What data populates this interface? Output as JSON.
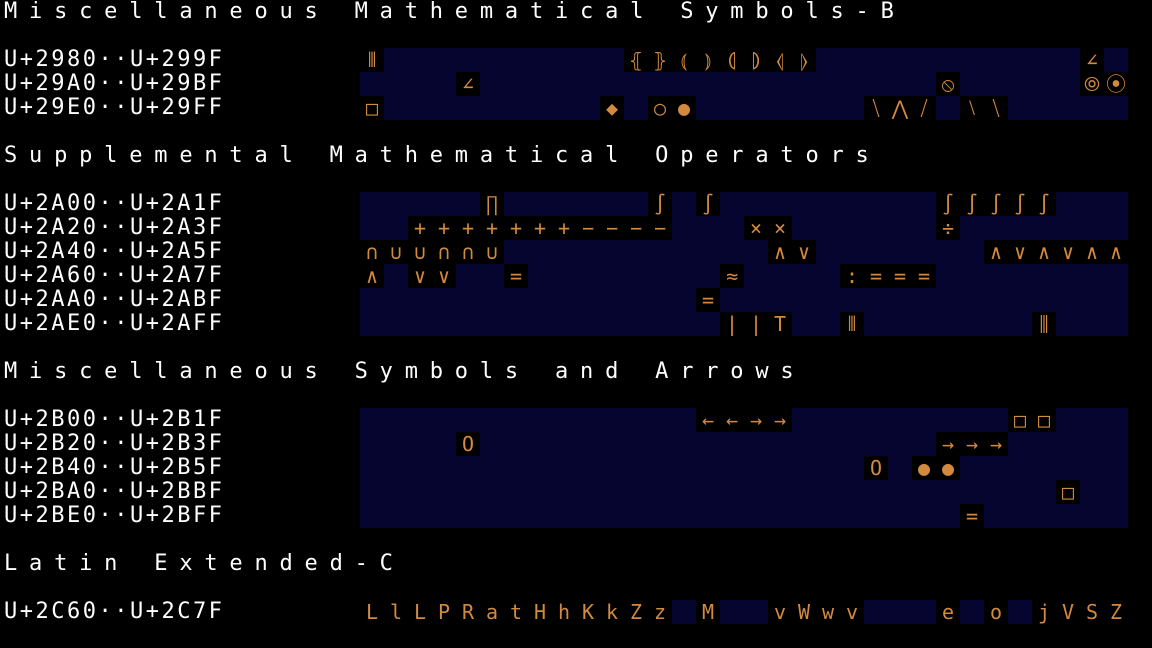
{
  "colors": {
    "background": "#000000",
    "band": "#050530",
    "glyph_bg": "#000000",
    "glyph": "#d28a3e",
    "text": "#ffffff"
  },
  "blocks": [
    {
      "title": "Miscellaneous Mathematical Symbols-B",
      "rows": [
        {
          "label": "U+2980··U+299F",
          "cells": [
            [
              0,
              "⦀"
            ],
            [
              11,
              "⦃"
            ],
            [
              12,
              "⦄"
            ],
            [
              13,
              "⦅"
            ],
            [
              14,
              "⦆"
            ],
            [
              15,
              "⦇"
            ],
            [
              16,
              "⦈"
            ],
            [
              17,
              "⦉"
            ],
            [
              18,
              "⦊"
            ],
            [
              30,
              "∠"
            ]
          ]
        },
        {
          "label": "U+29A0··U+29BF",
          "cells": [
            [
              4,
              "∠"
            ],
            [
              24,
              "⦸"
            ],
            [
              30,
              "⦾"
            ],
            [
              31,
              "⦿"
            ]
          ]
        },
        {
          "label": "U+29E0··U+29FF",
          "cells": [
            [
              0,
              "□"
            ],
            [
              10,
              "◆"
            ],
            [
              12,
              "○"
            ],
            [
              13,
              "●"
            ],
            [
              21,
              "⧹"
            ],
            [
              22,
              "⋀"
            ],
            [
              23,
              "⧸"
            ],
            [
              25,
              "⧵"
            ],
            [
              26,
              "⧹"
            ]
          ]
        }
      ]
    },
    {
      "title": "Supplemental Mathematical Operators",
      "rows": [
        {
          "label": "U+2A00··U+2A1F",
          "cells": [
            [
              5,
              "∏"
            ],
            [
              12,
              "∫"
            ],
            [
              14,
              "∫"
            ],
            [
              24,
              "∫"
            ],
            [
              25,
              "∫"
            ],
            [
              26,
              "∫"
            ],
            [
              27,
              "∫"
            ],
            [
              28,
              "∫"
            ]
          ]
        },
        {
          "label": "U+2A20··U+2A3F",
          "cells": [
            [
              2,
              "+"
            ],
            [
              3,
              "+"
            ],
            [
              4,
              "+"
            ],
            [
              5,
              "+"
            ],
            [
              6,
              "+"
            ],
            [
              7,
              "+"
            ],
            [
              8,
              "+"
            ],
            [
              9,
              "−"
            ],
            [
              10,
              "−"
            ],
            [
              11,
              "−"
            ],
            [
              12,
              "−"
            ],
            [
              16,
              "×"
            ],
            [
              17,
              "×"
            ],
            [
              24,
              "÷"
            ]
          ]
        },
        {
          "label": "U+2A40··U+2A5F",
          "cells": [
            [
              0,
              "∩"
            ],
            [
              1,
              "∪"
            ],
            [
              2,
              "∪"
            ],
            [
              3,
              "∩"
            ],
            [
              4,
              "∩"
            ],
            [
              5,
              "∪"
            ],
            [
              17,
              "∧"
            ],
            [
              18,
              "∨"
            ],
            [
              26,
              "∧"
            ],
            [
              27,
              "∨"
            ],
            [
              28,
              "∧"
            ],
            [
              29,
              "∨"
            ],
            [
              30,
              "∧"
            ],
            [
              31,
              "∧"
            ]
          ]
        },
        {
          "label": "U+2A60··U+2A7F",
          "cells": [
            [
              0,
              "∧"
            ],
            [
              2,
              "∨"
            ],
            [
              3,
              "∨"
            ],
            [
              6,
              "="
            ],
            [
              15,
              "≈"
            ],
            [
              20,
              ":"
            ],
            [
              21,
              "="
            ],
            [
              22,
              "="
            ],
            [
              23,
              "="
            ]
          ]
        },
        {
          "label": "U+2AA0··U+2ABF",
          "cells": [
            [
              14,
              "="
            ]
          ]
        },
        {
          "label": "U+2AE0··U+2AFF",
          "cells": [
            [
              15,
              "|"
            ],
            [
              16,
              "|"
            ],
            [
              17,
              "T"
            ],
            [
              20,
              "⫴"
            ],
            [
              28,
              "⫼"
            ]
          ]
        }
      ]
    },
    {
      "title": "Miscellaneous Symbols and Arrows",
      "rows": [
        {
          "label": "U+2B00··U+2B1F",
          "cells": [
            [
              14,
              "←"
            ],
            [
              15,
              "←"
            ],
            [
              16,
              "→"
            ],
            [
              17,
              "→"
            ],
            [
              27,
              "□"
            ],
            [
              28,
              "□"
            ]
          ]
        },
        {
          "label": "U+2B20··U+2B3F",
          "cells": [
            [
              4,
              "O"
            ],
            [
              24,
              "→"
            ],
            [
              25,
              "→"
            ],
            [
              26,
              "→"
            ]
          ]
        },
        {
          "label": "U+2B40··U+2B5F",
          "cells": [
            [
              21,
              "O"
            ],
            [
              23,
              "●"
            ],
            [
              24,
              "●"
            ]
          ]
        },
        {
          "label": "U+2BA0··U+2BBF",
          "cells": [
            [
              29,
              "□"
            ]
          ]
        },
        {
          "label": "U+2BE0··U+2BFF",
          "cells": [
            [
              25,
              "="
            ]
          ]
        }
      ]
    },
    {
      "title": "Latin Extended-C",
      "rows": [
        {
          "label": "U+2C60··U+2C7F",
          "cells": [
            [
              0,
              "L"
            ],
            [
              1,
              "l"
            ],
            [
              2,
              "L"
            ],
            [
              3,
              "P"
            ],
            [
              4,
              "R"
            ],
            [
              5,
              "a"
            ],
            [
              6,
              "t"
            ],
            [
              7,
              "H"
            ],
            [
              8,
              "h"
            ],
            [
              9,
              "K"
            ],
            [
              10,
              "k"
            ],
            [
              11,
              "Z"
            ],
            [
              12,
              "z"
            ],
            [
              14,
              "M"
            ],
            [
              17,
              "v"
            ],
            [
              18,
              "W"
            ],
            [
              19,
              "w"
            ],
            [
              20,
              "v"
            ],
            [
              24,
              "e"
            ],
            [
              26,
              "o"
            ],
            [
              28,
              "j"
            ],
            [
              29,
              "V"
            ],
            [
              30,
              "S"
            ],
            [
              31,
              "Z"
            ]
          ]
        }
      ]
    }
  ]
}
